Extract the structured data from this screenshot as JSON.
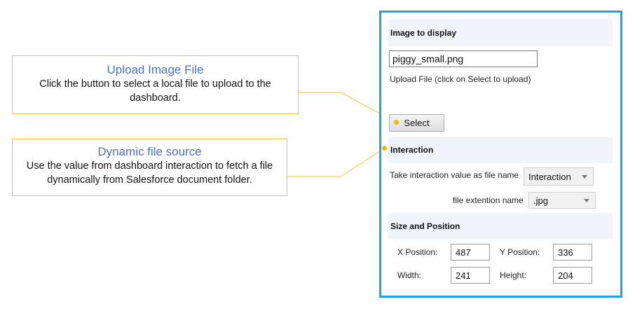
{
  "callouts": {
    "upload": {
      "title": "Upload Image File",
      "body": "Click the button  to select a local file to upload to the dashboard."
    },
    "dynamic": {
      "title": "Dynamic file source",
      "body": "Use the value from dashboard interaction to fetch a file dynamically from Salesforce document folder."
    }
  },
  "panel": {
    "image_section": {
      "header": "Image to display",
      "file_value": "piggy_small.png",
      "hint": "Upload File (click on Select to upload)",
      "select_label": "Select"
    },
    "interaction_section": {
      "header": "Interaction",
      "take_value_label": "Take interaction value as file name",
      "take_value_selected": "Interaction",
      "ext_label": "file extention name",
      "ext_selected": ".jpg"
    },
    "size_section": {
      "header": "Size and Position",
      "x_label": "X Position:",
      "x_value": "487",
      "y_label": "Y Position:",
      "y_value": "336",
      "width_label": "Width:",
      "width_value": "241",
      "height_label": "Height:",
      "height_value": "204"
    }
  },
  "colors": {
    "panel_border": "#1aa6df",
    "callout_border": "#f2c230",
    "callout_title": "#4a72b8",
    "connector_dot": "#f2b705"
  }
}
